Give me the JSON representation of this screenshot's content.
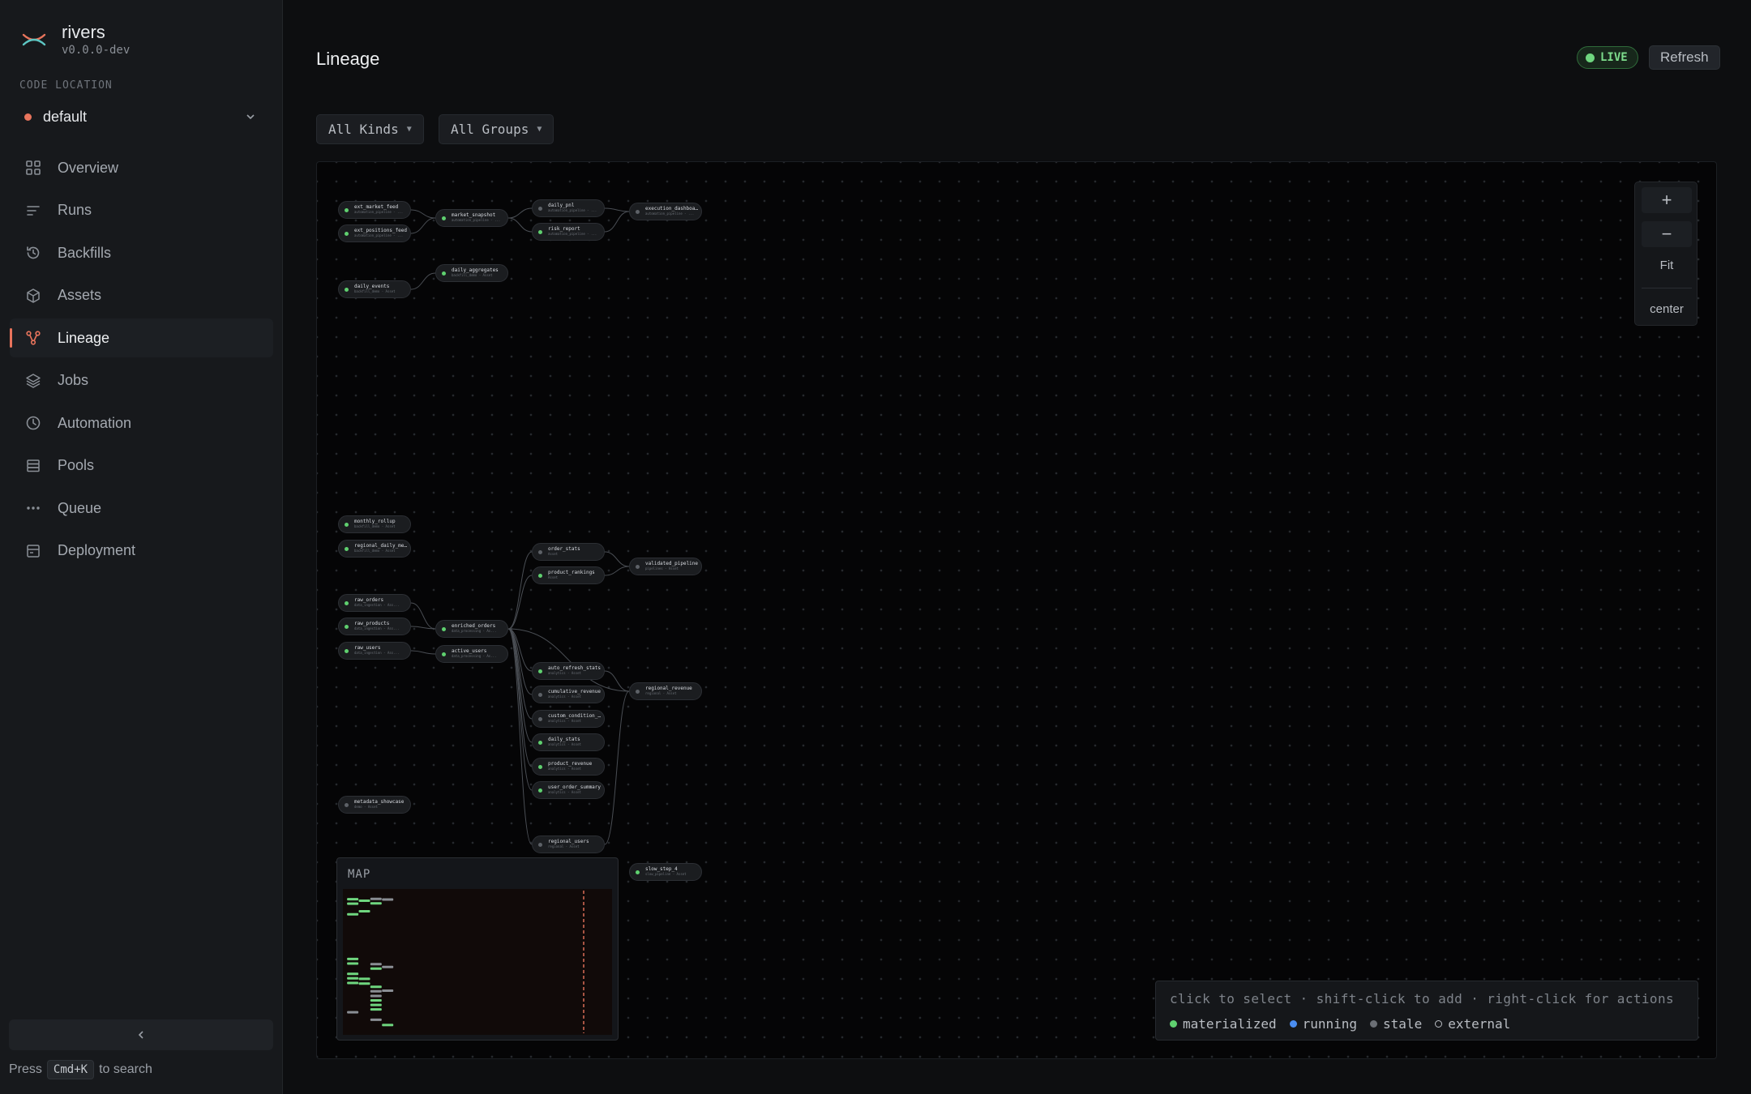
{
  "brand": {
    "name": "rivers",
    "version": "v0.0.0-dev"
  },
  "sidebar": {
    "section_label": "CODE LOCATION",
    "location": "default",
    "items": [
      {
        "label": "Overview",
        "icon": "grid-icon"
      },
      {
        "label": "Runs",
        "icon": "lines-icon"
      },
      {
        "label": "Backfills",
        "icon": "history-icon"
      },
      {
        "label": "Assets",
        "icon": "cube-icon"
      },
      {
        "label": "Lineage",
        "icon": "lineage-icon",
        "active": true
      },
      {
        "label": "Jobs",
        "icon": "layers-icon"
      },
      {
        "label": "Automation",
        "icon": "clock-icon"
      },
      {
        "label": "Pools",
        "icon": "database-icon"
      },
      {
        "label": "Queue",
        "icon": "dots-icon"
      },
      {
        "label": "Deployment",
        "icon": "server-icon"
      }
    ],
    "search_prefix": "Press",
    "search_key": "Cmd+K",
    "search_suffix": "to search"
  },
  "header": {
    "title": "Lineage",
    "live_label": "LIVE",
    "refresh_label": "Refresh"
  },
  "filters": {
    "kinds": "All Kinds",
    "groups": "All Groups"
  },
  "zoom": {
    "plus": "+",
    "minus": "−",
    "fit": "Fit",
    "center": "center"
  },
  "minimap": {
    "title": "MAP"
  },
  "help": {
    "line": "click to select · shift-click to add · right-click for actions",
    "legend": [
      {
        "label": "materialized",
        "color": "#5fd06f"
      },
      {
        "label": "running",
        "color": "#4a8df0"
      },
      {
        "label": "stale",
        "color": "#6b6f75"
      },
      {
        "label": "external",
        "color": "outline"
      }
    ]
  },
  "colors": {
    "accent": "#e8745c",
    "materialized": "#5fd06f",
    "running": "#4a8df0",
    "stale": "#6b6f75"
  },
  "graph": {
    "nodes": [
      {
        "name": "ext_market_feed",
        "sub": "automation_pipeline - ...",
        "status": "materialized"
      },
      {
        "name": "ext_positions_feed",
        "sub": "automation_pipeline - ...",
        "status": "materialized"
      },
      {
        "name": "market_snapshot",
        "sub": "automation_pipeline - ...",
        "status": "materialized"
      },
      {
        "name": "daily_pnl",
        "sub": "automation_pipeline - ...",
        "status": "stale"
      },
      {
        "name": "risk_report",
        "sub": "automation_pipeline - ...",
        "status": "materialized"
      },
      {
        "name": "execution_dashboa…",
        "sub": "automation_pipeline - ...",
        "status": "stale"
      },
      {
        "name": "daily_events",
        "sub": "backfill_demo - Asset",
        "status": "materialized"
      },
      {
        "name": "daily_aggregates",
        "sub": "backfill_demo - Asset",
        "status": "materialized"
      },
      {
        "name": "monthly_rollup",
        "sub": "backfill_demo - Asset",
        "status": "materialized"
      },
      {
        "name": "regional_daily_me…",
        "sub": "backfill_demo - Asset",
        "status": "materialized"
      },
      {
        "name": "order_stats",
        "sub": "Asset",
        "status": "stale"
      },
      {
        "name": "product_rankings",
        "sub": "Asset",
        "status": "materialized"
      },
      {
        "name": "validated_pipeline",
        "sub": "pipelines - Asset",
        "status": "stale"
      },
      {
        "name": "raw_orders",
        "sub": "data_ingestion - Ass...",
        "status": "materialized"
      },
      {
        "name": "raw_products",
        "sub": "data_ingestion - Ass...",
        "status": "materialized"
      },
      {
        "name": "raw_users",
        "sub": "data_ingestion - Ass...",
        "status": "materialized"
      },
      {
        "name": "enriched_orders",
        "sub": "data_processing - As...",
        "status": "materialized"
      },
      {
        "name": "active_users",
        "sub": "data_processing - As...",
        "status": "materialized"
      },
      {
        "name": "auto_refresh_stats",
        "sub": "analytics - Asset",
        "status": "materialized"
      },
      {
        "name": "cumulative_revenue",
        "sub": "analytics - Asset",
        "status": "stale"
      },
      {
        "name": "custom_condition_…",
        "sub": "analytics - Asset",
        "status": "stale"
      },
      {
        "name": "daily_stats",
        "sub": "analytics - Asset",
        "status": "materialized"
      },
      {
        "name": "product_revenue",
        "sub": "analytics - Asset",
        "status": "materialized"
      },
      {
        "name": "user_order_summary",
        "sub": "analytics - Asset",
        "status": "materialized"
      },
      {
        "name": "regional_revenue",
        "sub": "regional - Asset",
        "status": "stale"
      },
      {
        "name": "metadata_showcase",
        "sub": "demo - Asset",
        "status": "stale"
      },
      {
        "name": "regional_users",
        "sub": "regional - Asset",
        "status": "stale"
      },
      {
        "name": "slow_step_4",
        "sub": "slow_pipeline - Asset",
        "status": "materialized"
      }
    ]
  }
}
